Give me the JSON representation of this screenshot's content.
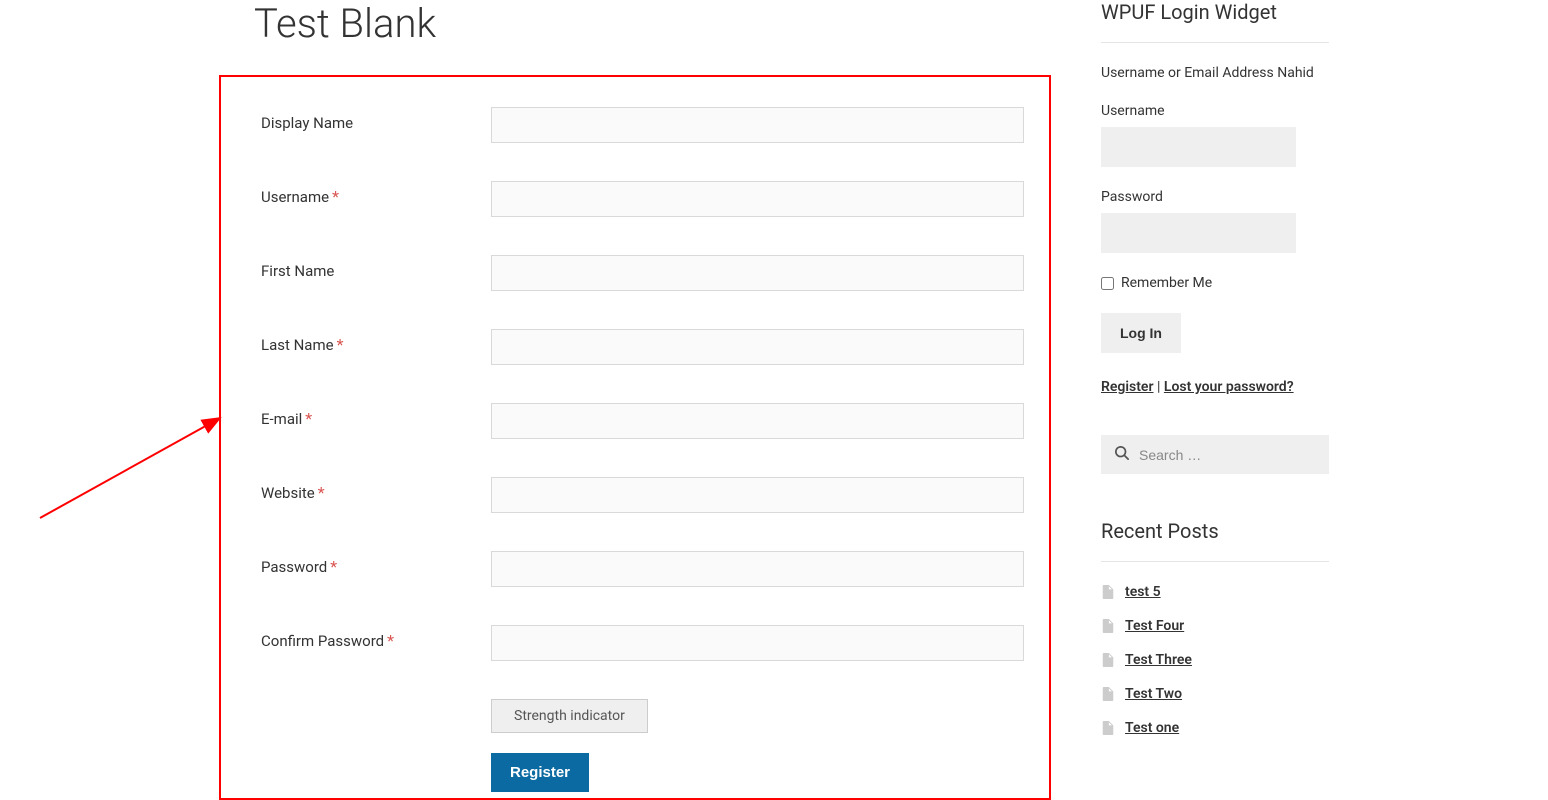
{
  "page_title": "Test Blank",
  "form": {
    "fields": [
      {
        "label": "Display Name",
        "required": false,
        "type": "text"
      },
      {
        "label": "Username",
        "required": true,
        "type": "text"
      },
      {
        "label": "First Name",
        "required": false,
        "type": "text"
      },
      {
        "label": "Last Name",
        "required": true,
        "type": "text"
      },
      {
        "label": "E-mail",
        "required": true,
        "type": "text"
      },
      {
        "label": "Website",
        "required": true,
        "type": "text"
      },
      {
        "label": "Password",
        "required": true,
        "type": "password"
      },
      {
        "label": "Confirm Password",
        "required": true,
        "type": "password"
      }
    ],
    "strength_indicator": "Strength indicator",
    "submit_label": "Register"
  },
  "login_widget": {
    "title": "WPUF Login Widget",
    "intro": "Username or Email Address Nahid",
    "username_label": "Username",
    "password_label": "Password",
    "remember_label": "Remember Me",
    "login_button": "Log In",
    "register_link": "Register",
    "separator": " | ",
    "lost_password_link": "Lost your password?"
  },
  "search": {
    "placeholder": "Search …"
  },
  "recent_posts": {
    "title": "Recent Posts",
    "items": [
      "test 5",
      "Test Four",
      "Test Three",
      "Test Two",
      "Test one"
    ]
  }
}
